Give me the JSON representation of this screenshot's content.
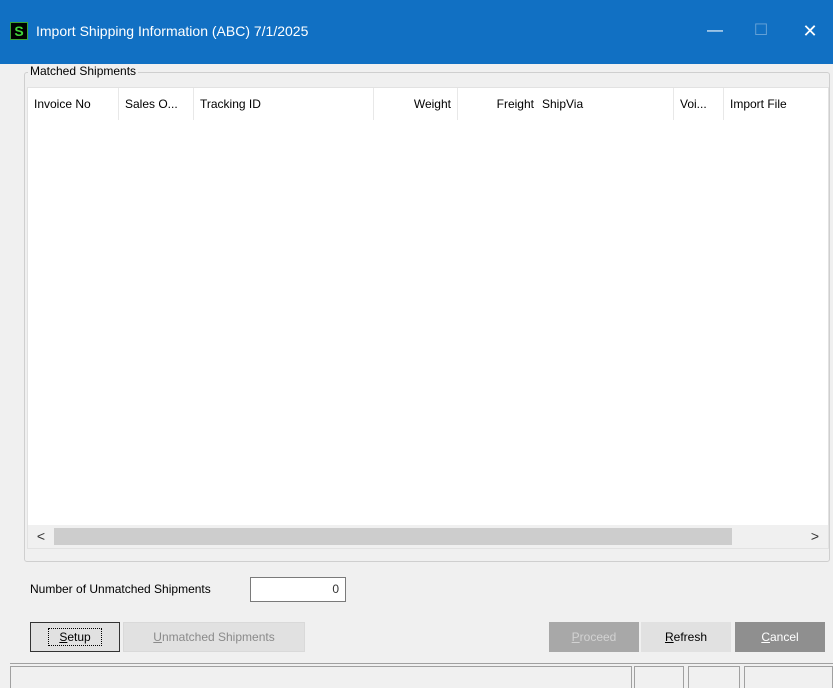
{
  "window": {
    "icon_letter": "S",
    "title": "Import Shipping Information (ABC) 7/1/2025",
    "minimize_glyph": "—",
    "maximize_glyph": "☐",
    "close_glyph": "✕"
  },
  "matched_shipments": {
    "group_label": "Matched Shipments",
    "columns": [
      {
        "label": "Invoice No"
      },
      {
        "label": "Sales O..."
      },
      {
        "label": "Tracking ID"
      },
      {
        "label": "Weight"
      },
      {
        "label": "Freight"
      },
      {
        "label": "ShipVia"
      },
      {
        "label": "Voi..."
      },
      {
        "label": "Import File"
      }
    ],
    "rows": [],
    "scroll_left": "<",
    "scroll_right": ">"
  },
  "unmatched": {
    "label": "Number of Unmatched Shipments",
    "value": "0"
  },
  "buttons": {
    "setup": {
      "accel": "S",
      "rest": "etup"
    },
    "unmatched": {
      "accel": "U",
      "rest": "nmatched Shipments"
    },
    "proceed": {
      "accel": "P",
      "rest": "roceed"
    },
    "refresh": {
      "accel": "R",
      "rest": "efresh"
    },
    "cancel": {
      "accel": "C",
      "rest": "ancel"
    }
  },
  "colors": {
    "titlebar": "#1170c3",
    "proceed_disabled": "#a8a8a8",
    "cancel": "#8f8f8f"
  }
}
